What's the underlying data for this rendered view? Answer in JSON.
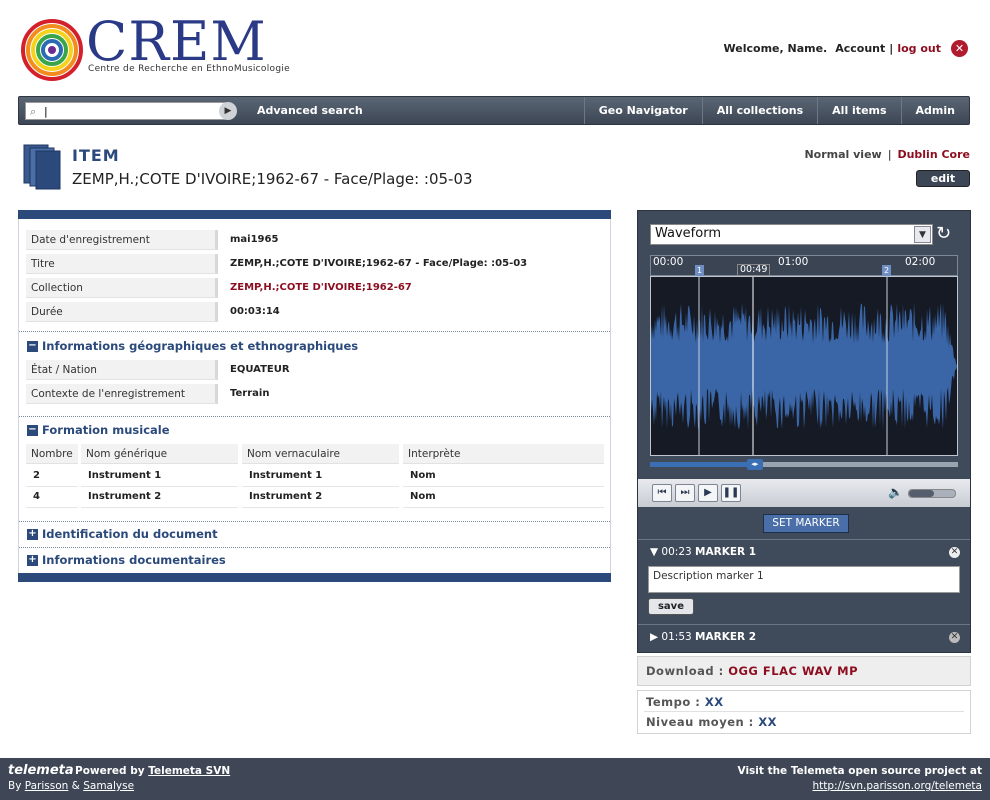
{
  "header": {
    "brand": "CREM",
    "subtitle": "Centre de Recherche en EthnoMusicologie",
    "welcome": "Welcome, Name.",
    "account": "Account",
    "separator": "|",
    "logout": "log out"
  },
  "nav": {
    "search_value": "|",
    "advanced_search": "Advanced search",
    "items": [
      "Geo Navigator",
      "All collections",
      "All items",
      "Admin"
    ]
  },
  "item": {
    "label": "ITEM",
    "title": "ZEMP,H.;COTE D'IVOIRE;1962-67 - Face/Plage: :05-03",
    "normal_view": "Normal view",
    "view_separator": "|",
    "dublin_core": "Dublin Core",
    "edit": "edit"
  },
  "fields": [
    {
      "label": "Date d'enregistrement",
      "value": "mai1965"
    },
    {
      "label": "Titre",
      "value": "ZEMP,H.;COTE D'IVOIRE;1962-67 - Face/Plage: :05-03"
    },
    {
      "label": "Collection",
      "value": "ZEMP,H.;COTE D'IVOIRE;1962-67"
    },
    {
      "label": "Durée",
      "value": "00:03:14"
    }
  ],
  "geo_section": {
    "toggle": "−",
    "title": "Informations géographiques et ethnographiques",
    "fields": [
      {
        "label": "État / Nation",
        "value": "EQUATEUR"
      },
      {
        "label": "Contexte de l'enregistrement",
        "value": "Terrain"
      }
    ]
  },
  "music_section": {
    "toggle": "−",
    "title": "Formation musicale",
    "columns": [
      "Nombre",
      "Nom générique",
      "Nom vernaculaire",
      "Interprète"
    ],
    "rows": [
      [
        "2",
        "Instrument 1",
        "Instrument 1",
        "Nom"
      ],
      [
        "4",
        "Instrument 2",
        "Instrument 2",
        "Nom"
      ]
    ]
  },
  "collapsed_sections": [
    {
      "toggle": "+",
      "title": "Identification du document"
    },
    {
      "toggle": "+",
      "title": "Informations documentaires"
    }
  ],
  "player": {
    "visualizer": "Waveform",
    "timeline": {
      "ticks": [
        "00:00",
        "01:00",
        "02:00"
      ],
      "current": "00:49",
      "marker_numbers": [
        "1",
        "2"
      ]
    },
    "progress_fraction": 0.34,
    "volume_fraction": 0.55,
    "set_marker": "SET MARKER",
    "markers": [
      {
        "time": "00:23",
        "name": "MARKER 1",
        "description": "Description marker 1",
        "save": "save"
      },
      {
        "time": "01:53",
        "name": "MARKER 2"
      }
    ]
  },
  "download": {
    "label": "Download :",
    "formats": [
      "OGG",
      "FLAC",
      "WAV",
      "MP"
    ]
  },
  "analysis": [
    {
      "label": "Tempo :",
      "value": "XX"
    },
    {
      "label": "Niveau moyen :",
      "value": "XX"
    }
  ],
  "footer": {
    "brand": "telemeta",
    "powered_prefix": "Powered by",
    "powered_link": "Telemeta SVN",
    "by_prefix": "By",
    "by_a": "Parisson",
    "by_amp": "&",
    "by_b": "Samalyse",
    "visit": "Visit the Telemeta open source project at",
    "url": "http://svn.parisson.org/telemeta"
  },
  "colors": {
    "brand_blue": "#2b3a87",
    "section_blue": "#2b4a7b",
    "link_red": "#8c0d1f",
    "waveform": "#3a66a8",
    "player_bg": "#3f4b5b"
  }
}
